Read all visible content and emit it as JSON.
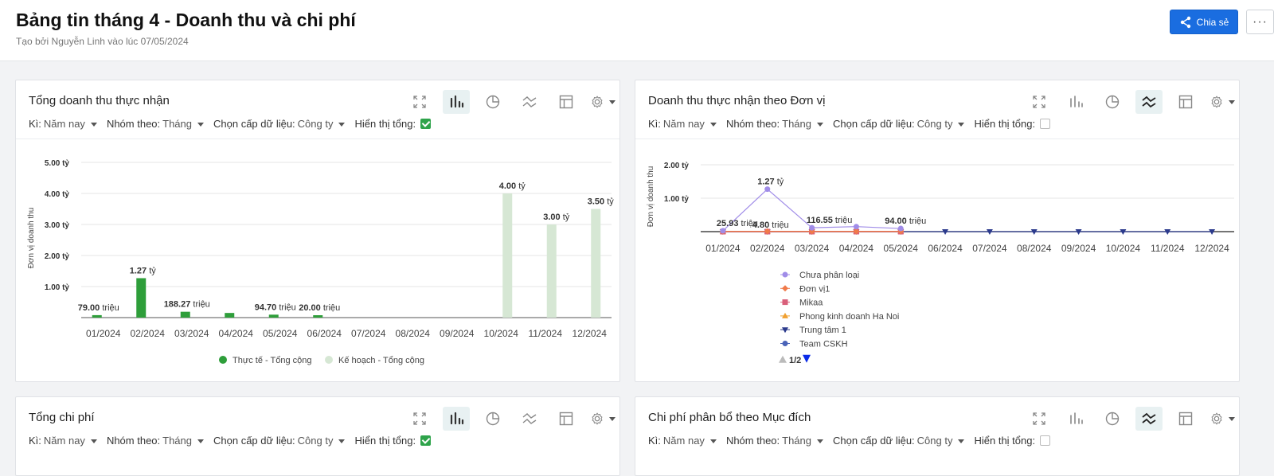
{
  "header": {
    "title": "Bảng tin tháng 4 - Doanh thu và chi phí",
    "subtitle": "Tạo bởi Nguyễn Linh vào lúc 07/05/2024",
    "share_label": "Chia sẻ",
    "more_label": "···"
  },
  "filters": {
    "period_label": "Kì:",
    "period_value": "Năm nay",
    "group_label": "Nhóm theo:",
    "group_value": "Tháng",
    "level_label": "Chọn cấp dữ liệu:",
    "level_value": "Công ty",
    "show_total_label": "Hiển thị tổng:"
  },
  "cards": {
    "revenue_total": {
      "title": "Tổng doanh thu thực nhận",
      "show_total": true
    },
    "revenue_unit": {
      "title": "Doanh thu thực nhận theo Đơn vị",
      "show_total": false
    },
    "cost_total": {
      "title": "Tổng chi phí",
      "show_total": true
    },
    "cost_purpose": {
      "title": "Chi phí phân bổ theo Mục đích",
      "show_total": false
    }
  },
  "chart_data": [
    {
      "type": "bar",
      "ylabel": "Đơn vị doanh thu",
      "yticks": [
        "1.00 tỷ",
        "2.00 tỷ",
        "3.00 tỷ",
        "4.00 tỷ",
        "5.00 tỷ"
      ],
      "ylim": [
        0,
        5
      ],
      "categories": [
        "01/2024",
        "02/2024",
        "03/2024",
        "04/2024",
        "05/2024",
        "06/2024",
        "07/2024",
        "08/2024",
        "09/2024",
        "10/2024",
        "11/2024",
        "12/2024"
      ],
      "series": [
        {
          "name": "Thực tế - Tổng cộng",
          "color": "#2e9e3a",
          "values": [
            0.079,
            1.27,
            0.18827,
            0.15,
            0.0947,
            0.02,
            0,
            0,
            0,
            0,
            0,
            0
          ]
        },
        {
          "name": "Kế hoạch - Tổng cộng",
          "color": "#d6e7d4",
          "values": [
            0,
            0,
            0,
            0,
            0,
            0,
            0,
            0,
            0,
            4.0,
            3.0,
            3.5
          ]
        }
      ],
      "data_labels": [
        {
          "series": 0,
          "index": 0,
          "num": "79.00",
          "unit": "triệu"
        },
        {
          "series": 0,
          "index": 1,
          "num": "1.27",
          "unit": "tỷ"
        },
        {
          "series": 0,
          "index": 2,
          "num": "188.27",
          "unit": "triệu"
        },
        {
          "series": 0,
          "index": 4,
          "num": "94.70",
          "unit": "triệu"
        },
        {
          "series": 0,
          "index": 5,
          "num": "20.00",
          "unit": "triệu"
        },
        {
          "series": 1,
          "index": 9,
          "num": "4.00",
          "unit": "tỷ"
        },
        {
          "series": 1,
          "index": 10,
          "num": "3.00",
          "unit": "tỷ"
        },
        {
          "series": 1,
          "index": 11,
          "num": "3.50",
          "unit": "tỷ"
        }
      ]
    },
    {
      "type": "line",
      "ylabel": "Đơn vị doanh thu",
      "yticks": [
        "1.00 tỷ",
        "2.00 tỷ"
      ],
      "ylim": [
        0,
        2
      ],
      "categories": [
        "01/2024",
        "02/2024",
        "03/2024",
        "04/2024",
        "05/2024",
        "06/2024",
        "07/2024",
        "08/2024",
        "09/2024",
        "10/2024",
        "11/2024",
        "12/2024"
      ],
      "series": [
        {
          "name": "Chưa phân loại",
          "color": "#a08ce8",
          "marker": "circle",
          "values": [
            0.02593,
            1.27,
            0.11655,
            0.15,
            0.094,
            null,
            null,
            null,
            null,
            null,
            null,
            null
          ]
        },
        {
          "name": "Đơn vị1",
          "color": "#f07a4a",
          "marker": "diamond",
          "values": [
            0.01,
            0.01,
            0.01,
            0.01,
            0.01,
            null,
            null,
            null,
            null,
            null,
            null,
            null
          ]
        },
        {
          "name": "Mikaa",
          "color": "#d95f7a",
          "marker": "square",
          "values": [
            0,
            0,
            0,
            0,
            0,
            null,
            null,
            null,
            null,
            null,
            null,
            null
          ]
        },
        {
          "name": "Phong kinh doanh Ha Noi",
          "color": "#f0a030",
          "marker": "triangle",
          "values": [
            0,
            0,
            0,
            0,
            0,
            null,
            null,
            null,
            null,
            null,
            null,
            null
          ]
        },
        {
          "name": "Trung tâm 1",
          "color": "#2b3a8c",
          "marker": "triangle-down",
          "values": [
            0,
            0,
            0,
            0,
            0,
            0,
            0,
            0,
            0,
            0,
            0,
            0
          ]
        },
        {
          "name": "Team CSKH",
          "color": "#4a63b8",
          "marker": "circle",
          "values": [
            0,
            0,
            0,
            0,
            0,
            null,
            null,
            null,
            null,
            null,
            null,
            null
          ]
        }
      ],
      "data_labels": [
        {
          "index": 0,
          "num": "25.93",
          "unit": "triệu"
        },
        {
          "index": 1,
          "num": "1.27",
          "unit": "tỷ"
        },
        {
          "index": 1,
          "num": "4.80",
          "unit": "triệu",
          "second": true
        },
        {
          "index": 2,
          "num": "116.55",
          "unit": "triệu"
        },
        {
          "index": 4,
          "num": "94.00",
          "unit": "triệu"
        }
      ],
      "legend_page": "1/2"
    }
  ]
}
